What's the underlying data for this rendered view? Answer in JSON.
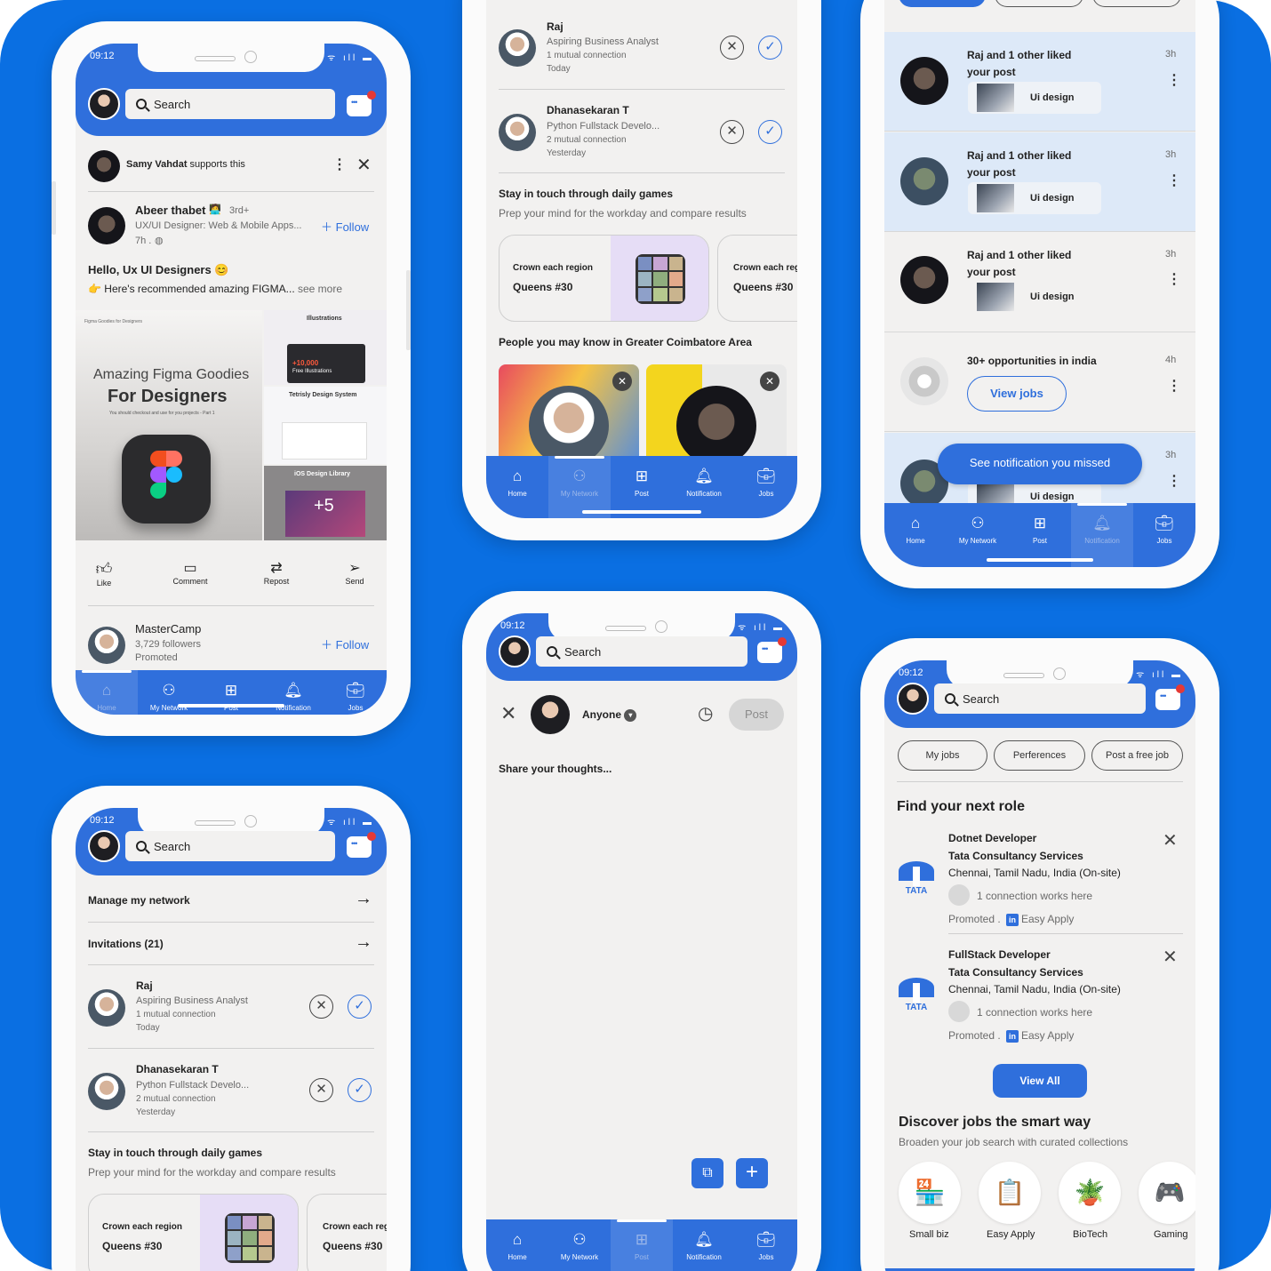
{
  "status": {
    "time": "09:12"
  },
  "search": {
    "placeholder": "Search"
  },
  "nav": {
    "home": "Home",
    "network": "My Network",
    "post": "Post",
    "notification": "Notification",
    "jobs": "Jobs"
  },
  "feed": {
    "supporter": "Samy Vahdat",
    "supports_text": "supports this",
    "author": "Abeer thabet",
    "degree": "3rd+",
    "headline": "UX/UI Designer: Web & Mobile Apps...",
    "time": "7h .",
    "follow": "Follow",
    "title": "Hello, Ux UI Designers",
    "body": "Here's recommended amazing FIGMA...",
    "see_more": "see more",
    "img_title_1": "Amazing Figma Goodies",
    "img_title_2": "For Designers",
    "img_sub": "You should checkout and use for you projects - Part 1",
    "img_small": "Figma Goodies for Designers",
    "side_1": "Illustrations",
    "side_1_badge": "+10,000",
    "side_1_badge_sub": "Free Illustrations",
    "side_2": "Tetrisly Design System",
    "side_3": "iOS Design Library",
    "plus_more": "+5",
    "actions": {
      "like": "Like",
      "comment": "Comment",
      "repost": "Repost",
      "send": "Send"
    },
    "promo_name": "MasterCamp",
    "promo_followers": "3,729 followers",
    "promo_label": "Promoted"
  },
  "network": {
    "manage": "Manage my network",
    "invitations": "Invitations",
    "invitations_count": "(21)",
    "invites": [
      {
        "name": "Raj",
        "headline": "Aspiring Business Analyst",
        "mutual": "1 mutual connection",
        "when": "Today"
      },
      {
        "name": "Dhanasekaran T",
        "headline": "Python Fullstack Develo...",
        "mutual": "2 mutual connection",
        "when": "Yesterday"
      }
    ],
    "games_title": "Stay in touch through daily games",
    "games_sub": "Prep your mind for the workday and compare results",
    "game_label": "Crown each region",
    "game_label_cut": "Crown each reg",
    "game_name": "Queens #30",
    "people_title": "People you may know in Greater Coimbatore Area"
  },
  "post": {
    "audience": "Anyone",
    "post_btn": "Post",
    "placeholder": "Share your thoughts..."
  },
  "notifications": {
    "items": [
      {
        "line1": "Raj and 1 other liked",
        "line2": "your post",
        "thumb": "Ui design",
        "time": "3h"
      },
      {
        "line1": "Raj and 1 other liked",
        "line2": "your post",
        "thumb": "Ui design",
        "time": "3h"
      },
      {
        "line1": "Raj and 1 other liked",
        "line2": "your post",
        "thumb": "Ui design",
        "time": "3h"
      },
      {
        "line1": "30+ opportunities in india",
        "time": "4h",
        "button": "View jobs"
      },
      {
        "thumb": "Ui design",
        "time": "3h"
      }
    ],
    "missed": "See notification you missed"
  },
  "jobs": {
    "filters": [
      "My jobs",
      "Perferences",
      "Post a free job"
    ],
    "find_title": "Find your next role",
    "list": [
      {
        "title": "Dotnet Developer",
        "company": "Tata Consultancy Services",
        "location": "Chennai, Tamil Nadu, India (On-site)",
        "connections": "1 connection works here",
        "promoted": "Promoted .",
        "apply": "Easy Apply"
      },
      {
        "title": "FullStack Developer",
        "company": "Tata Consultancy Services",
        "location": "Chennai, Tamil Nadu, India (On-site)",
        "connections": "1 connection works here",
        "promoted": "Promoted .",
        "apply": "Easy Apply"
      }
    ],
    "logo_text": "TATA",
    "view_all": "View All",
    "discover_title": "Discover jobs the smart way",
    "discover_sub": "Broaden your job search with curated collections",
    "categories": [
      "Small biz",
      "Easy Apply",
      "BioTech",
      "Gaming"
    ]
  },
  "colors": {
    "brand": "#2f6fdc",
    "background": "#0a6fe2",
    "unread": "#dde9f8"
  },
  "icons": [
    "search-icon",
    "message-icon",
    "home-icon",
    "network-icon",
    "post-icon",
    "bell-icon",
    "jobs-icon",
    "close-icon",
    "check-icon",
    "kebab-icon",
    "arrow-right-icon",
    "clock-icon",
    "image-icon",
    "plus-icon"
  ]
}
